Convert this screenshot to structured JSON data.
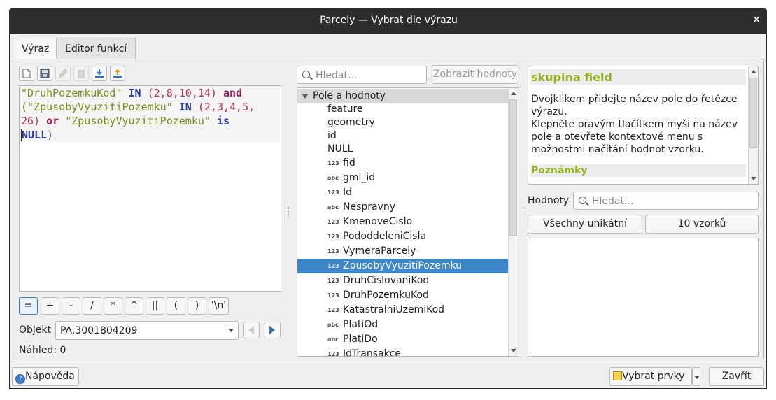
{
  "window": {
    "title": "Parcely — Vybrat dle výrazu",
    "close_glyph": "×"
  },
  "tabs": [
    {
      "label": "Výraz",
      "active": true
    },
    {
      "label": "Editor funkcí",
      "active": false
    }
  ],
  "toolbar": {
    "icons": [
      "new-file-icon",
      "save-icon",
      "edit-icon",
      "delete-icon",
      "import-icon",
      "export-icon"
    ]
  },
  "editor": {
    "lines": [
      [
        "\"DruhPozemkuKod\"",
        " IN ",
        "(2,8,10,14)",
        " and"
      ],
      [
        "(\"ZpusobyVyuzitiPozemku\"",
        " IN ",
        "(2,3,4,5,"
      ],
      [
        "26)",
        " or ",
        "\"ZpusobyVyuzitiPozemku\"",
        " is"
      ],
      [
        "NULL",
        ")"
      ]
    ]
  },
  "operators": [
    "=",
    "+",
    "-",
    "/",
    "*",
    "^",
    "||",
    "(",
    ")",
    "'\\n'"
  ],
  "preview": {
    "object_label": "Objekt",
    "object_value": "PA.3001804209",
    "preview_label": "Náhled:",
    "preview_value": "0"
  },
  "middle": {
    "search_placeholder": "Hledat...",
    "show_values_button": "Zobrazit hodnoty",
    "tree": {
      "group_label": "Pole a hodnoty",
      "items": [
        {
          "type": "",
          "name": "feature"
        },
        {
          "type": "",
          "name": "geometry"
        },
        {
          "type": "",
          "name": "id"
        },
        {
          "type": "",
          "name": "NULL"
        },
        {
          "type": "123",
          "name": "fid"
        },
        {
          "type": "abc",
          "name": "gml_id"
        },
        {
          "type": "123",
          "name": "Id"
        },
        {
          "type": "abc",
          "name": "Nespravny"
        },
        {
          "type": "123",
          "name": "KmenoveCislo"
        },
        {
          "type": "123",
          "name": "PododdeleniCisla"
        },
        {
          "type": "123",
          "name": "VymeraParcely"
        },
        {
          "type": "123",
          "name": "ZpusobyVyuzitiPozemku",
          "selected": true
        },
        {
          "type": "123",
          "name": "DruhCislovaniKod"
        },
        {
          "type": "123",
          "name": "DruhPozemkuKod"
        },
        {
          "type": "123",
          "name": "KatastralniUzemiKod"
        },
        {
          "type": "abc",
          "name": "PlatiOd"
        },
        {
          "type": "abc",
          "name": "PlatiDo"
        },
        {
          "type": "123",
          "name": "IdTransakce"
        }
      ]
    }
  },
  "help": {
    "heading": "skupina field",
    "text_1": "Dvojklikem přidejte název pole do řetězce výrazu.",
    "text_2": "Klepněte pravým tlačítkem myši na název pole a otevřete kontextové menu s možnostmi načítání hodnot vzorku.",
    "notes_heading": "Poznámky"
  },
  "values": {
    "label": "Hodnoty",
    "search_placeholder": "Hledat...",
    "all_unique_button": "Všechny unikátní",
    "samples_button": "10 vzorků"
  },
  "footer": {
    "help_button": "Nápověda",
    "select_button": "Vybrat prvky",
    "close_button": "Zavřít"
  },
  "colors": {
    "selection": "#3d87c9",
    "help_heading": "#93b023",
    "string_literal": "#7c8d1a",
    "keyword": "#2a3aa0",
    "number": "#b12e4a"
  }
}
